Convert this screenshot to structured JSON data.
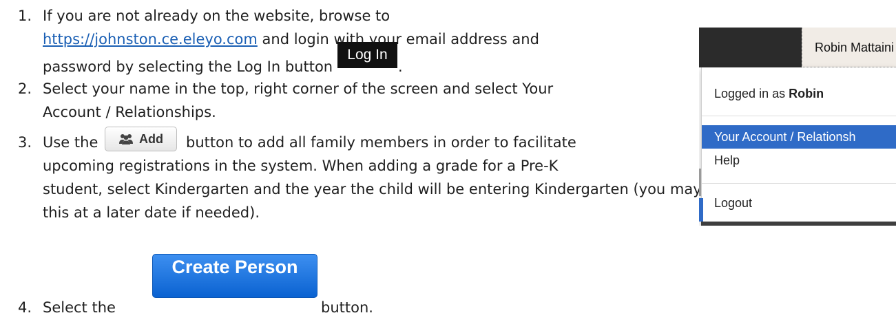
{
  "steps": [
    {
      "number": "1.",
      "line1": "If you are not already on the website, browse to",
      "url": "https://johnston.ce.eleyo.com",
      "line2_after_url": " and login with your email address and",
      "line3": "password by selecting the Log In button",
      "line3_end": "."
    },
    {
      "number": "2.",
      "line1": "Select your name in the top, right corner of the screen and select Your",
      "line2": "Account / Relationships."
    },
    {
      "number": "3.",
      "line1_before": "Use the",
      "line1_after": "button to add all family members in order to facilitate",
      "line2": "upcoming registrations in the system.  When adding a grade for a Pre-K",
      "line3": "student, select Kindergarten and the year the child will be entering Kindergarten (you may edit",
      "line4": "this at a later date if needed)."
    },
    {
      "number": "4.",
      "line1_before": "Select the",
      "line1_after": "button."
    }
  ],
  "buttons": {
    "login": "Log In",
    "add": "Add",
    "create_person": "Create Person"
  },
  "dropdown": {
    "user_name": "Robin Mattaini",
    "logged_in_prefix": "Logged in as ",
    "logged_in_name": "Robin",
    "items": [
      "Your Account / Relationsh",
      "Help",
      "Logout"
    ]
  },
  "colors": {
    "link": "#1a5fb4",
    "create_button": "#0a62d1",
    "menu_highlight": "#2f6bc7"
  },
  "icons": {
    "add_button_icon": "users-icon"
  }
}
